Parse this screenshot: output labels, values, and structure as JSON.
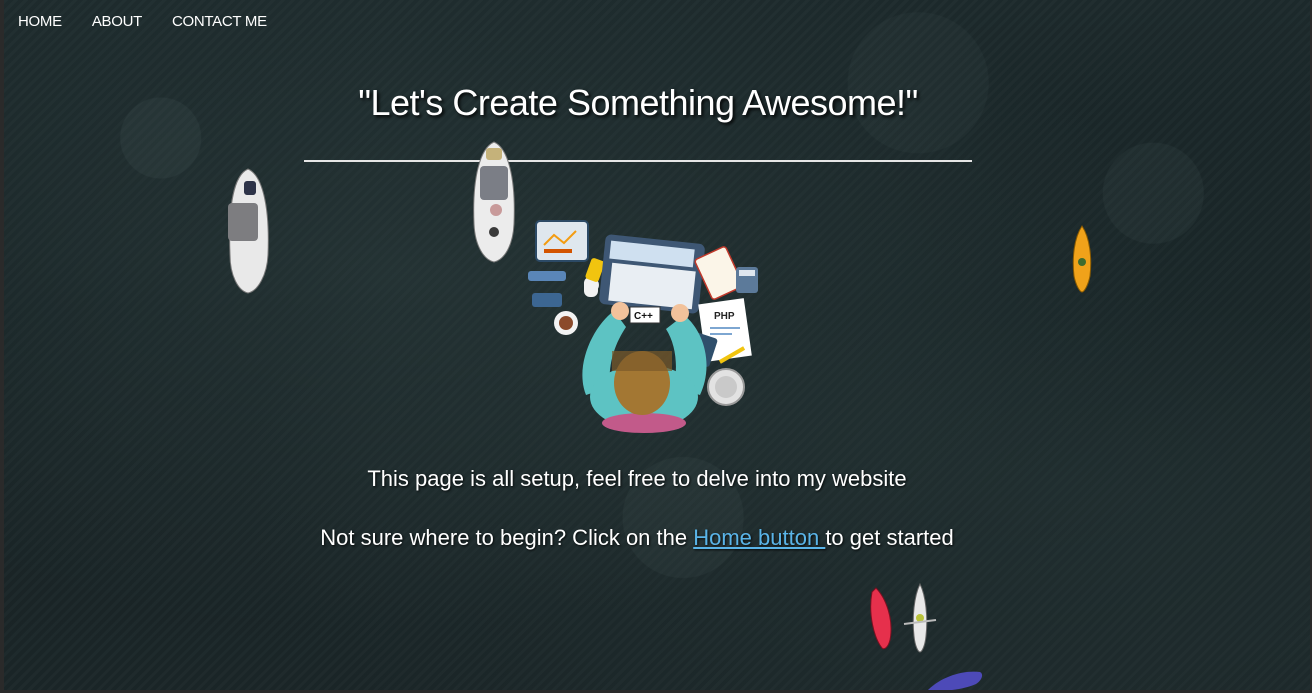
{
  "nav": {
    "items": [
      {
        "label": "HOME"
      },
      {
        "label": "ABOUT"
      },
      {
        "label": "CONTACT ME"
      }
    ]
  },
  "hero": {
    "title": "\"Let's Create Something Awesome!\""
  },
  "illustration": {
    "paper_label": "PHP",
    "keyboard_label": "C++"
  },
  "body": {
    "intro": "This page is all setup, feel free to delve into my website",
    "cta_prefix": "Not sure where to begin? Click on the ",
    "cta_link": "Home button ",
    "cta_suffix": "to get started"
  },
  "colors": {
    "background": "#1b2628",
    "text": "#ffffff",
    "link": "#5ab4e8",
    "rule": "#e6e6e6"
  }
}
